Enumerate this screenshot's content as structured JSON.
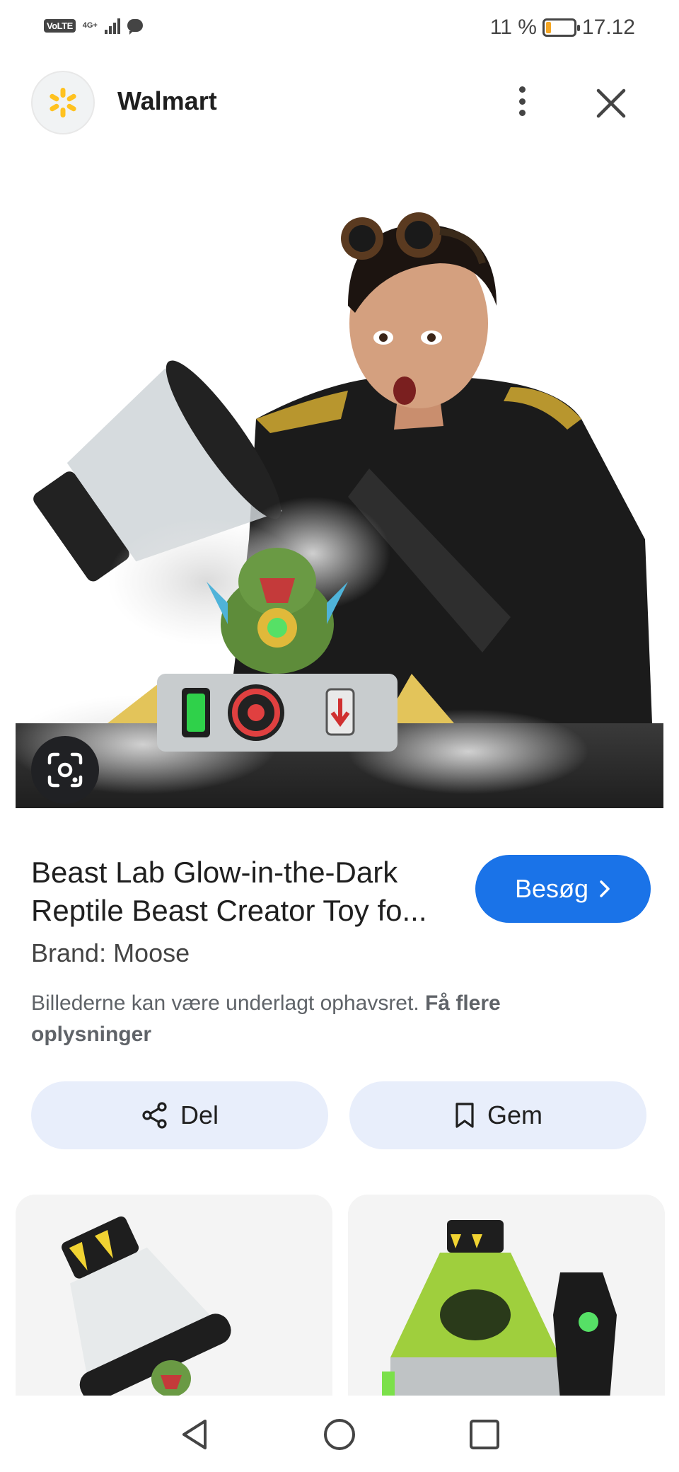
{
  "status_bar": {
    "volte": "VoLTE",
    "network": "4G+",
    "battery": "11 %",
    "time": "17.12"
  },
  "header": {
    "site": "Walmart",
    "logo_icon": "walmart-spark-icon",
    "more_icon": "more-vert-icon",
    "close_icon": "close-icon"
  },
  "product": {
    "title_line1": "Beast Lab Glow-in-the-Dark",
    "title_line2": "Reptile Beast Creator Toy fo...",
    "visit_label": "Besøg",
    "brand": "Brand: Moose",
    "copyright": "Billederne kan være underlagt ophavsret.",
    "copyright_link": "Få flere oplysninger"
  },
  "actions": {
    "share_label": "Del",
    "save_label": "Gem"
  },
  "colors": {
    "accent": "#1a73e8",
    "pill_bg": "#e8eefb",
    "walmart_yellow": "#ffc220"
  }
}
